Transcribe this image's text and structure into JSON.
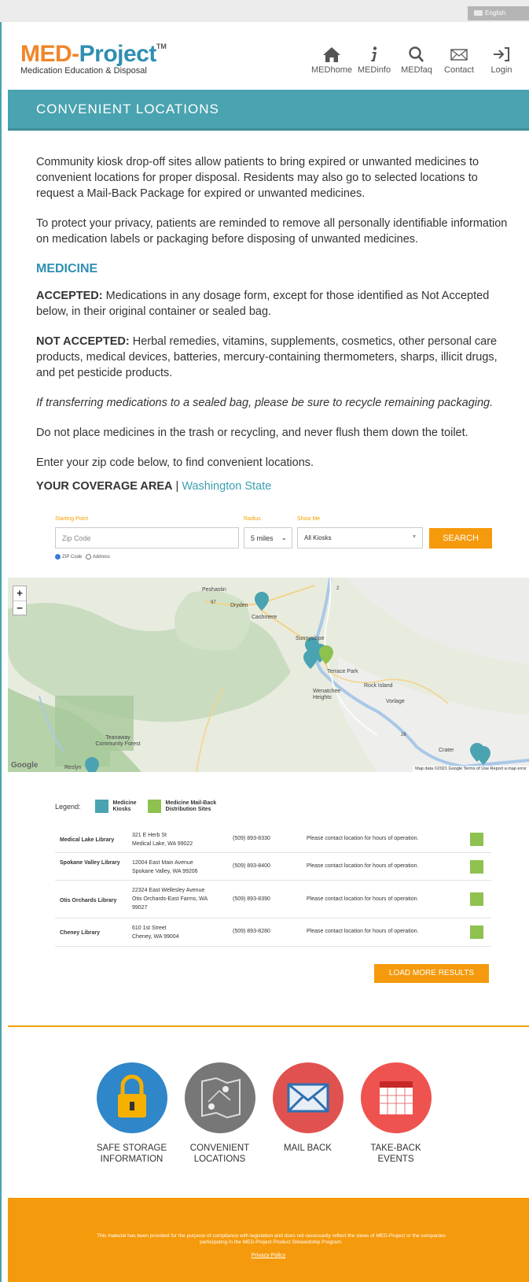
{
  "language": "English",
  "logo": {
    "med": "MED-",
    "project": "Project",
    "tm": "TM",
    "tagline": "Medication Education & Disposal"
  },
  "nav": [
    {
      "label": "MEDhome"
    },
    {
      "label": "MEDinfo"
    },
    {
      "label": "MEDfaq"
    },
    {
      "label": "Contact"
    },
    {
      "label": "Login"
    }
  ],
  "banner": {
    "title": "CONVENIENT LOCATIONS"
  },
  "content": {
    "p1": "Community kiosk drop-off sites allow patients to bring expired or unwanted medicines to convenient locations for proper disposal. Residents may also go to selected locations to request a Mail-Back Package for expired or unwanted medicines.",
    "p2": "To protect your privacy, patients are reminded to remove all personally identifiable information on medication labels or packaging before disposing of unwanted medicines.",
    "medicine_heading": "MEDICINE",
    "accepted_label": "ACCEPTED:",
    "accepted_text": " Medications in any dosage form, except for those identified as Not Accepted below, in their original container or sealed bag.",
    "not_accepted_label": "NOT ACCEPTED:",
    "not_accepted_text": " Herbal remedies, vitamins, supplements, cosmetics, other personal care products, medical devices, batteries, mercury-containing thermometers, sharps, illicit drugs, and pet pesticide products.",
    "italic_note": "If transferring medications to a sealed bag, please be sure to recycle remaining packaging.",
    "trash_note": "Do not place medicines in the trash or recycling, and never flush them down the toilet.",
    "zip_prompt": "Enter your zip code below, to find convenient locations.",
    "coverage_label": "YOUR COVERAGE AREA",
    "coverage_sep": " | ",
    "coverage_link": "Washington State"
  },
  "search": {
    "starting_point_label": "Starting Point",
    "zip_placeholder": "Zip Code",
    "radius_label": "Radius",
    "radius_value": "5 miles",
    "show_me_label": "Show Me",
    "show_me_value": "All Kiosks",
    "button": "SEARCH",
    "radio_zip": "ZIP Code",
    "radio_address": "Address"
  },
  "map": {
    "labels": [
      "Peshastin",
      "Dryden",
      "Cashmere",
      "Sunnyslope",
      "Terrace Park",
      "Rock Island",
      "Wenatchee Heights",
      "Vorlage",
      "Teanaway Community Forest",
      "Crater",
      "Reslyn",
      "97",
      "2",
      "28"
    ],
    "google": "Google",
    "attribution": "Map data ©2021 Google   Terms of Use   Report a map error",
    "zoom_in": "+",
    "zoom_out": "−"
  },
  "legend": {
    "label": "Legend:",
    "kiosk": "Medicine Kiosks",
    "mailback": "Medicine Mail-Back Distribution Sites"
  },
  "locations": [
    {
      "name": "Medical Lake Library",
      "addr1": "321 E Herb St",
      "addr2": "Medical Lake, WA 99022",
      "addr3": "",
      "phone": "(509) 893-8330",
      "hours": "Please contact location for hours of operation."
    },
    {
      "name": "Spokane Valley Library",
      "addr1": "12004 East Main Avenue",
      "addr2": "Spokane Valley, WA 99206",
      "addr3": "",
      "phone": "(509) 893-8400",
      "hours": "Please contact location for hours of operation."
    },
    {
      "name": "Otis Orchards Library",
      "addr1": "22324 East Wellesley Avenue",
      "addr2": "Otis Orchards-East Farms, WA",
      "addr3": "99027",
      "phone": "(509) 893-8390",
      "hours": "Please contact location for hours of operation."
    },
    {
      "name": "Cheney Library",
      "addr1": "610 1st Street",
      "addr2": "Cheney, WA 99004",
      "addr3": "",
      "phone": "(509) 893-8280",
      "hours": "Please contact location for hours of operation."
    }
  ],
  "load_more": "LOAD MORE RESULTS",
  "features": [
    {
      "line1": "SAFE STORAGE",
      "line2": "INFORMATION",
      "color": "#2f86c8"
    },
    {
      "line1": "CONVENIENT",
      "line2": "LOCATIONS",
      "color": "#777777"
    },
    {
      "line1": "MAIL BACK",
      "line2": "",
      "color": "#e0524f"
    },
    {
      "line1": "TAKE-BACK",
      "line2": "EVENTS",
      "color": "#ef5350"
    }
  ],
  "footer": {
    "text": "This material has been provided for the purpose of compliance with legislation and does not necessarily reflect the views of MED-Project or the companies participating in the MED-Project Product Stewardship Program.",
    "privacy": "Privacy Policy"
  },
  "colors": {
    "teal": "#4aa3b0",
    "orange": "#f59a0c",
    "blue": "#2f8fb0",
    "green": "#8ec14f"
  }
}
